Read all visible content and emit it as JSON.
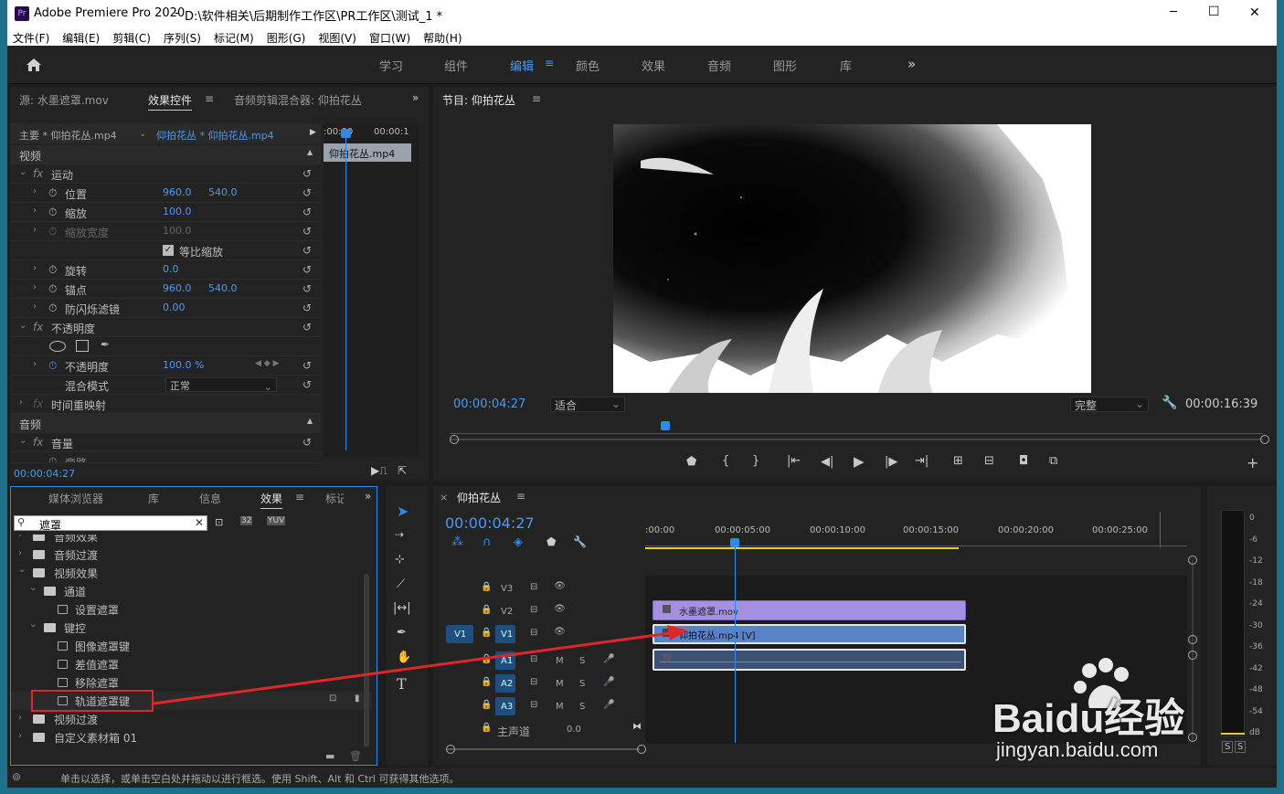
{
  "title": {
    "app": "Adobe Premiere Pro 2020",
    "path": "D:\\软件相关\\后期制作工作区\\PR工作区\\测试_1 *",
    "logo": "Pr",
    "minimize": "─",
    "maximize": "☐",
    "close": "✕"
  },
  "menu": [
    "文件(F)",
    "编辑(E)",
    "剪辑(C)",
    "序列(S)",
    "标记(M)",
    "图形(G)",
    "视图(V)",
    "窗口(W)",
    "帮助(H)"
  ],
  "workspaces": [
    "学习",
    "组件",
    "编辑",
    "颜色",
    "效果",
    "音频",
    "图形",
    "库"
  ],
  "active_workspace": "编辑",
  "source_panel": {
    "tabs": [
      "源: 水墨遮罩.mov",
      "效果控件",
      "音频剪辑混合器: 仰拍花丛"
    ],
    "master": "主要 * 仰拍花丛.mp4",
    "clip": "仰拍花丛 * 仰拍花丛.mp4",
    "tc1": ":00:00",
    "tc2": "00:00:1",
    "mini_clip": "仰拍花丛.mp4",
    "timecode": "00:00:04:27",
    "sections": {
      "video": "视频",
      "audio": "音频"
    },
    "rows": [
      {
        "label": "运动"
      },
      {
        "label": "位置",
        "v1": "960.0",
        "v2": "540.0"
      },
      {
        "label": "缩放",
        "v1": "100.0"
      },
      {
        "label": "缩放宽度",
        "v1": "100.0"
      },
      {
        "label": "等比缩放"
      },
      {
        "label": "旋转",
        "v1": "0.0"
      },
      {
        "label": "锚点",
        "v1": "960.0",
        "v2": "540.0"
      },
      {
        "label": "防闪烁滤镜",
        "v1": "0.00"
      },
      {
        "label": "不透明度"
      },
      {
        "label": "不透明度",
        "v1": "100.0 %"
      },
      {
        "label": "混合模式",
        "v1": "正常"
      },
      {
        "label": "时间重映射"
      },
      {
        "label": "音量"
      },
      {
        "label": "旁路"
      }
    ]
  },
  "program": {
    "title": "节目: 仰拍花丛",
    "timecode": "00:00:04:27",
    "fit": "适合",
    "quality": "完整",
    "duration": "00:00:16:39"
  },
  "effects_panel": {
    "tabs": [
      "媒体浏览器",
      "库",
      "信息",
      "效果",
      "标记"
    ],
    "search": "遮罩",
    "tree": [
      "音频效果",
      "音频过渡",
      "视频效果",
      "通道",
      "设置遮罩",
      "键控",
      "图像遮罩键",
      "差值遮罩",
      "移除遮罩",
      "轨道遮罩键",
      "视频过渡",
      "自定义素材箱 01"
    ]
  },
  "timeline": {
    "title": "仰拍花丛",
    "timecode": "00:00:04:27",
    "ruler": [
      ":00:00",
      "00:00:05:00",
      "00:00:10:00",
      "00:00:15:00",
      "00:00:20:00",
      "00:00:25:00"
    ],
    "tracks": {
      "v3": "V3",
      "v2": "V2",
      "v1": "V1",
      "src": "V1",
      "a1": "A1",
      "a2": "A2",
      "a3": "A3",
      "master": "主声道",
      "master_val": "0.0",
      "m": "M",
      "s": "S"
    },
    "clips": {
      "mask": "水墨遮罩.mov",
      "video": "仰拍花丛.mp4 [V]"
    }
  },
  "meter": {
    "labels": [
      "0",
      "-6",
      "-12",
      "-18",
      "-24",
      "-30",
      "-36",
      "-42",
      "-48",
      "-54",
      "dB"
    ],
    "solo": "S"
  },
  "status": "单击以选择，或单击空白处并拖动以进行框选。使用 Shift、Alt 和 Ctrl 可获得其他选项。",
  "watermark": {
    "brand": "Baidu经验",
    "url": "jingyan.baidu.com"
  },
  "colors": {
    "accent": "#2d8ceb",
    "mask_clip": "#a58fe0",
    "video_clip": "#5a82c9",
    "highlight_box": "#e0262a",
    "arrow": "#e0262a"
  }
}
